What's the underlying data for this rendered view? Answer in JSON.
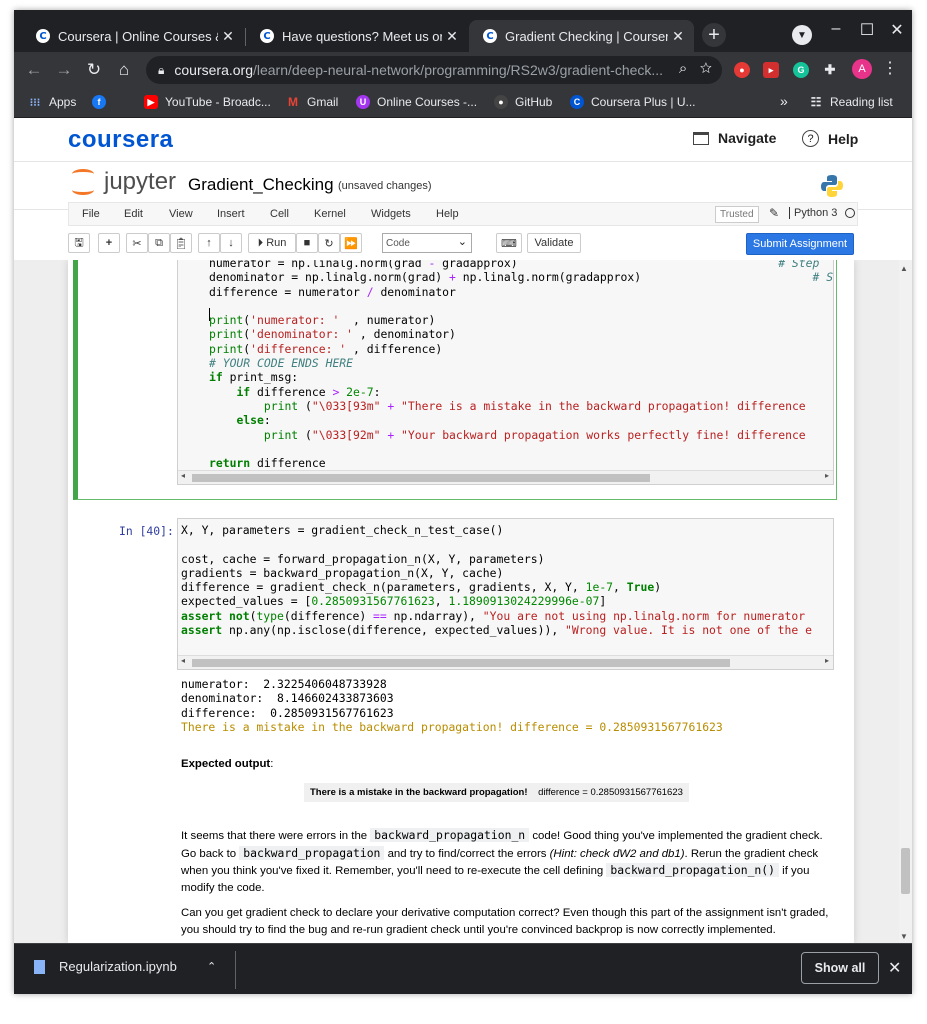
{
  "browser": {
    "tabs": [
      {
        "title": "Coursera | Online Courses & C",
        "favicon": "C",
        "active": false
      },
      {
        "title": "Have questions? Meet us on D",
        "favicon": "C",
        "active": false
      },
      {
        "title": "Gradient Checking | Coursera",
        "favicon": "C",
        "active": true
      }
    ],
    "close_glyph": "✕",
    "new_tab_glyph": "+",
    "url_host": "coursera.org",
    "url_path": "/learn/deep-neural-network/programming/RS2w3/gradient-check...",
    "avatar_letter": "A",
    "bookmarks": [
      {
        "label": "Apps",
        "icon": "apps-grid-icon"
      },
      {
        "label": "",
        "icon": "facebook-icon"
      },
      {
        "label": "YouTube - Broadc...",
        "icon": "youtube-icon"
      },
      {
        "label": "Gmail",
        "icon": "gmail-icon"
      },
      {
        "label": "Online Courses -...",
        "icon": "udemy-icon"
      },
      {
        "label": "GitHub",
        "icon": "github-icon"
      },
      {
        "label": "Coursera Plus | U...",
        "icon": "coursera-icon"
      }
    ],
    "more_bookmarks": "»",
    "reading_list": "Reading list"
  },
  "coursera": {
    "logo": "coursera",
    "navigate": "Navigate",
    "help": "Help"
  },
  "jupyter": {
    "logo": "jupyter",
    "notebook_name": "Gradient_Checking",
    "status": "(unsaved changes)",
    "menus": [
      "File",
      "Edit",
      "View",
      "Insert",
      "Cell",
      "Kernel",
      "Widgets",
      "Help"
    ],
    "trusted": "Trusted",
    "kernel": "Python 3",
    "run_label": "Run",
    "cell_type": "Code",
    "validate": "Validate",
    "submit": "Submit Assignment"
  },
  "cells": {
    "cell2_prompt": "In [40]:",
    "output_lines": [
      "numerator:  2.3225406048733928",
      "denominator:  8.146602433873603",
      "difference:  0.2850931567761623"
    ],
    "output_warning": "There is a mistake in the backward propagation! difference = 0.2850931567761623"
  },
  "markdown": {
    "expected_label": "Expected output",
    "expected_colon": ":",
    "expected_msg": "There is a mistake in the backward propagation!",
    "expected_diff": "difference = 0.2850931567761623",
    "p1_a": "It seems that there were errors in the ",
    "p1_code1": "backward_propagation_n",
    "p1_b": " code! Good thing you've implemented the gradient check. Go back to ",
    "p1_code2": "backward_propagation",
    "p1_c": " and try to find/correct the errors ",
    "p1_hint": "(Hint: check dW2 and db1)",
    "p1_d": ". Rerun the gradient check when you think you've fixed it. Remember, you'll need to re-execute the cell defining ",
    "p1_code3": "backward_propagation_n()",
    "p1_e": " if you modify the code.",
    "p2": "Can you get gradient check to declare your derivative computation correct? Even though this part of the assignment isn't graded, you should try to find the bug and re-run gradient check until you're convinced backprop is now correctly implemented."
  },
  "downloads": {
    "file": "Regularization.ipynb",
    "show_all": "Show all"
  }
}
